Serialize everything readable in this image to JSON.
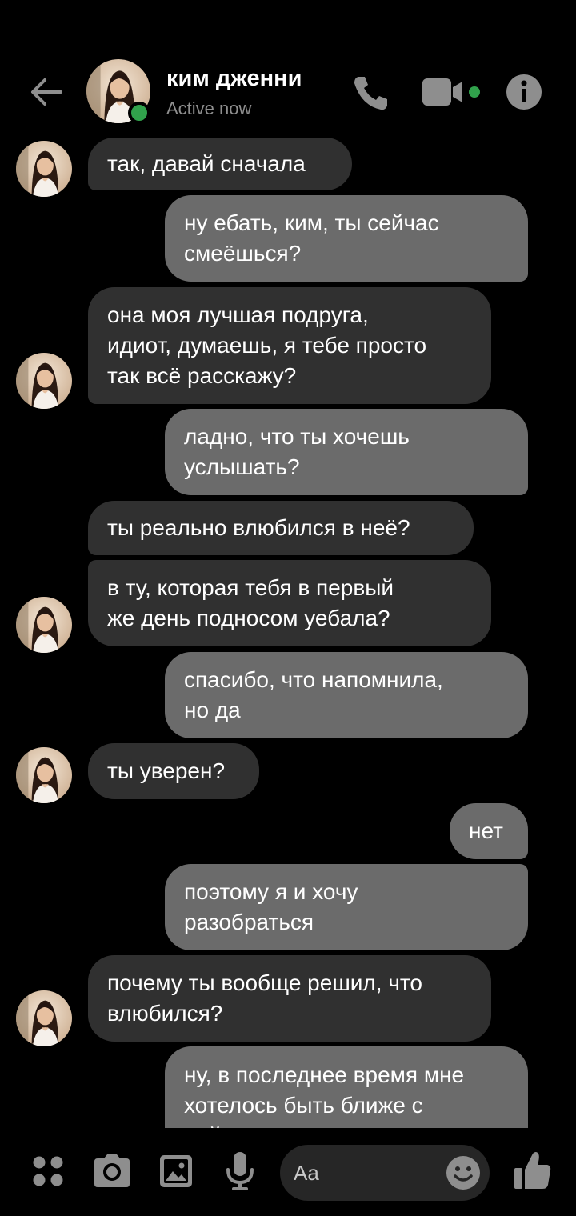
{
  "header": {
    "contact_name": "ким дженни",
    "status": "Active now"
  },
  "messages": [
    {
      "side": "in",
      "text": "так, давай сначала"
    },
    {
      "side": "out",
      "text": "ну ебать, ким, ты сейчас\nсмеёшься?"
    },
    {
      "side": "in",
      "text": "она моя лучшая подруга,\nидиот, думаешь, я тебе просто\nтак всё расскажу?"
    },
    {
      "side": "out",
      "text": "ладно, что ты хочешь\nуслышать?"
    },
    {
      "side": "in",
      "text": "ты реально влюбился в неё?"
    },
    {
      "side": "in",
      "text": "в ту, которая тебя в первый\nже день подносом уебала?"
    },
    {
      "side": "out",
      "text": "спасибо, что напомнила,\nно да"
    },
    {
      "side": "in",
      "text": "ты уверен?"
    },
    {
      "side": "out",
      "text": "нет"
    },
    {
      "side": "out",
      "text": "поэтому я и хочу\nразобраться"
    },
    {
      "side": "in",
      "text": "почему ты вообще решил, что\nвлюбился?"
    },
    {
      "side": "out",
      "text": "ну, в последнее время мне\nхотелось быть ближе с\nней"
    }
  ],
  "composer": {
    "placeholder": "Aa"
  },
  "colors": {
    "incoming_bubble": "#303030",
    "outgoing_bubble": "#6b6b6b",
    "online": "#31a24c",
    "background": "#000000"
  },
  "icons": [
    "back-arrow-icon",
    "phone-icon",
    "video-camera-icon",
    "info-icon",
    "apps-icon",
    "camera-icon",
    "gallery-icon",
    "microphone-icon",
    "emoji-icon",
    "thumbs-up-icon"
  ]
}
